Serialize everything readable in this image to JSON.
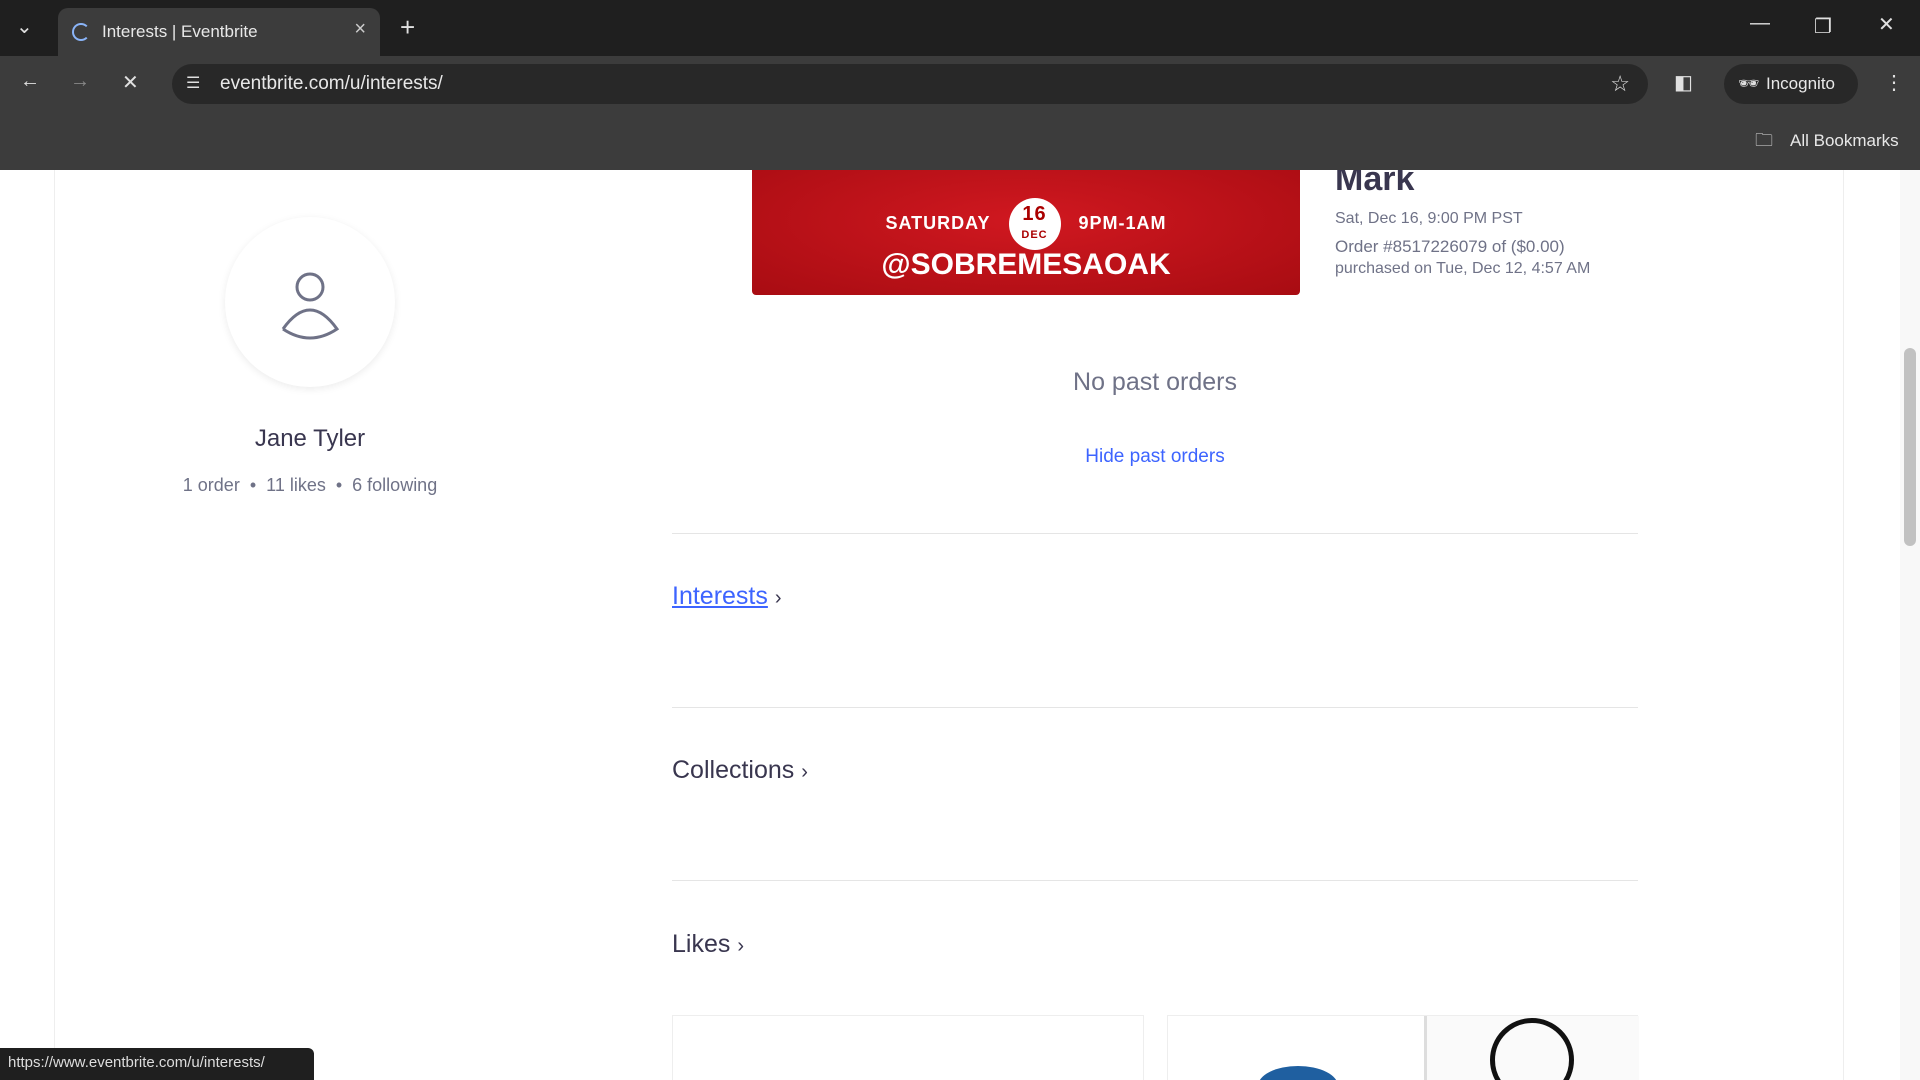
{
  "browser": {
    "tab_title": "Interests | Eventbrite",
    "url": "eventbrite.com/u/interests/",
    "incognito_label": "Incognito",
    "bookmarks_label": "All Bookmarks",
    "status_url": "https://www.eventbrite.com/u/interests/"
  },
  "profile": {
    "name": "Jane Tyler",
    "orders": "1 order",
    "likes": "11 likes",
    "following": "6 following"
  },
  "order": {
    "banner": {
      "day": "SATURDAY",
      "date_num": "16",
      "date_month": "DEC",
      "time": "9PM-1AM",
      "handle": "@SOBREMESAOAK"
    },
    "title": "Mark",
    "date": "Sat, Dec 16, 9:00 PM PST",
    "order_line": "Order #8517226079 of ($0.00)",
    "purchased": "purchased on Tue, Dec 12, 4:57 AM"
  },
  "past": {
    "empty": "No past orders",
    "hide_link": "Hide past orders"
  },
  "sections": {
    "interests": "Interests",
    "collections": "Collections",
    "likes": "Likes"
  },
  "colors": {
    "link": "#3d64ff",
    "text": "#39364f"
  }
}
